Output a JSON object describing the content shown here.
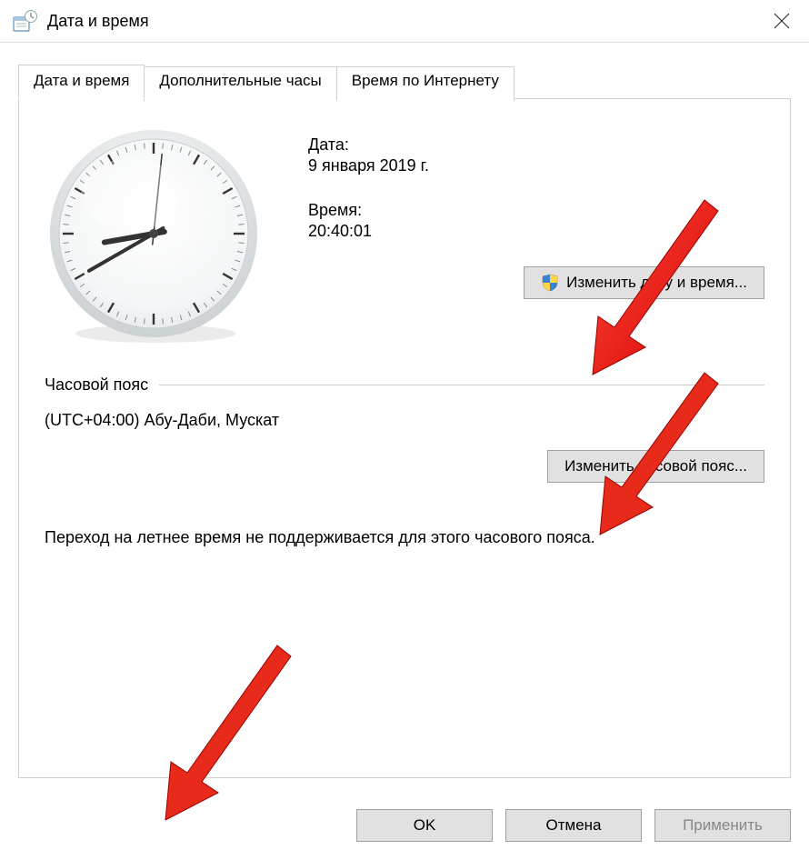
{
  "window": {
    "title": "Дата и время"
  },
  "tabs": [
    {
      "label": "Дата и время",
      "active": true
    },
    {
      "label": "Дополнительные часы",
      "active": false
    },
    {
      "label": "Время по Интернету",
      "active": false
    }
  ],
  "date": {
    "label": "Дата:",
    "value": "9 января 2019 г."
  },
  "time": {
    "label": "Время:",
    "value": "20:40:01"
  },
  "buttons": {
    "change_datetime": "Изменить дату и время...",
    "change_timezone": "Изменить часовой пояс...",
    "ok": "OK",
    "cancel": "Отмена",
    "apply": "Применить"
  },
  "timezone": {
    "heading": "Часовой пояс",
    "value": "(UTC+04:00) Абу-Даби, Мускат"
  },
  "dst_note": "Переход на летнее время не поддерживается для этого часового пояса.",
  "clock": {
    "hour": 8,
    "minute": 40,
    "second": 1
  }
}
